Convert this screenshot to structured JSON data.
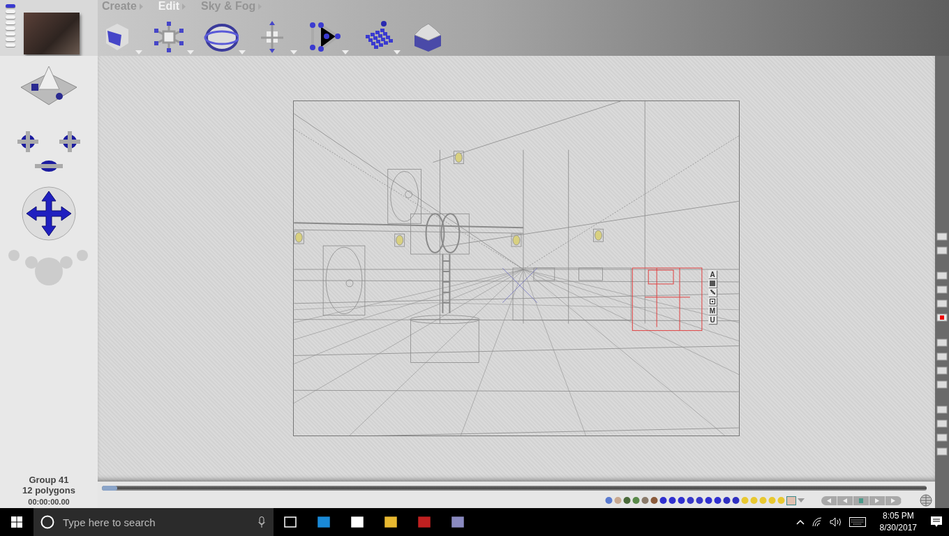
{
  "menus": [
    {
      "label": "Create",
      "selected": false
    },
    {
      "label": "Edit",
      "selected": true
    },
    {
      "label": "Sky & Fog",
      "selected": false
    }
  ],
  "selection_handles": [
    {
      "kind": "letter",
      "label": "A"
    },
    {
      "kind": "square"
    },
    {
      "kind": "link"
    },
    {
      "kind": "frame"
    },
    {
      "kind": "letter",
      "label": "M"
    },
    {
      "kind": "letter",
      "label": "U"
    }
  ],
  "status": {
    "object": "Group 41",
    "polygons": "12 polygons",
    "time": "00:00:00.00"
  },
  "taskbar": {
    "search": {
      "placeholder": "Type here to search"
    },
    "time": "8:05 PM",
    "date": "8/30/2017"
  }
}
